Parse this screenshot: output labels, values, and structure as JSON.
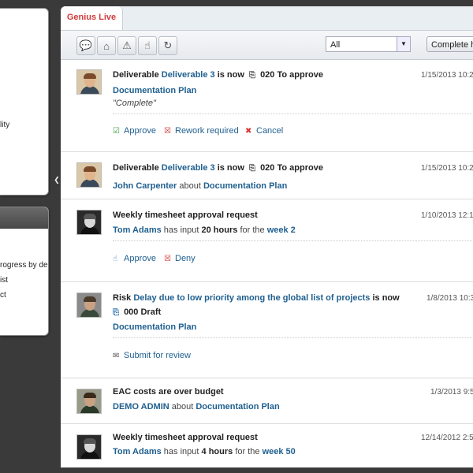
{
  "left_panels": {
    "panel1_lines": [
      "lity"
    ],
    "panel2_lines": [
      "rogress by deli",
      "ist",
      "ct"
    ]
  },
  "tab": {
    "label": "Genius Live"
  },
  "toolbar": {
    "icons": [
      "comments-icon",
      "inbox-icon",
      "warning-icon",
      "hand-icon",
      "refresh-icon"
    ],
    "filter_value": "All",
    "status_value": "Complete hi"
  },
  "items": [
    {
      "subject_type": "Deliverable",
      "subject_link": "Deliverable 3",
      "verb": "is now",
      "status": "020 To approve",
      "date": "1/15/2013 10:2",
      "line2_link": "Documentation Plan",
      "comment": "\"Complete\"",
      "actions": [
        "Approve",
        "Rework required",
        "Cancel"
      ]
    },
    {
      "subject_type": "Deliverable",
      "subject_link": "Deliverable 3",
      "verb": "is now",
      "status": "020 To approve",
      "date": "1/15/2013 10:2",
      "person": "John Carpenter",
      "about": "about",
      "line2_link": "Documentation Plan"
    },
    {
      "title": "Weekly timesheet approval request",
      "date": "1/10/2013 12:1",
      "person": "Tom Adams",
      "has_input": "has input",
      "hours": "20 hours",
      "for_the": "for the",
      "week": "week 2",
      "actions": [
        "Approve",
        "Deny"
      ]
    },
    {
      "subject_type": "Risk",
      "subject_link": "Delay due to low priority among the global list of projects",
      "verb": "is now",
      "status": "000 Draft",
      "date": "1/8/2013 10:3",
      "line2_link": "Documentation Plan",
      "actions": [
        "Submit for review"
      ]
    },
    {
      "title": "EAC costs are over budget",
      "date": "1/3/2013 9:5",
      "person": "DEMO ADMIN",
      "about": "about",
      "line2_link": "Documentation Plan"
    },
    {
      "title": "Weekly timesheet approval request",
      "date": "12/14/2012 2:5",
      "person": "Tom Adams",
      "has_input": "has input",
      "hours": "4 hours",
      "for_the": "for the",
      "week": "week 50"
    }
  ]
}
